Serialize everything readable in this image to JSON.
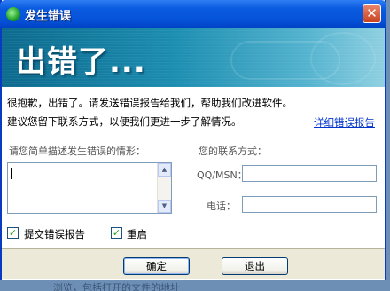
{
  "window": {
    "title": "发生错误",
    "close_label": "✕"
  },
  "banner": {
    "heading": "出错了..."
  },
  "message": {
    "line1": "很抱歉，出错了。请发送错误报告给我们，帮助我们改进软件。",
    "line2": "建议您留下联系方式，以便我们更进一步了解情况。",
    "details_link": "详细错误报告"
  },
  "form": {
    "description_label": "请您简单描述发生错误的情形：",
    "description_value": "",
    "contact_label": "您的联系方式：",
    "qq_label": "QQ/MSN：",
    "qq_value": "",
    "phone_label": "电话：",
    "phone_value": ""
  },
  "options": {
    "submit_report": {
      "label": "提交错误报告",
      "checked": true
    },
    "restart": {
      "label": "重启",
      "checked": true
    }
  },
  "buttons": {
    "ok": "确定",
    "exit": "退出"
  },
  "background_partial_text": "浏览，包括打开的文件的地址",
  "colors": {
    "title_bar": "#0553d8",
    "banner": "#1b8db0",
    "link": "#0033cc",
    "dialog_bg": "#ece9d8"
  }
}
